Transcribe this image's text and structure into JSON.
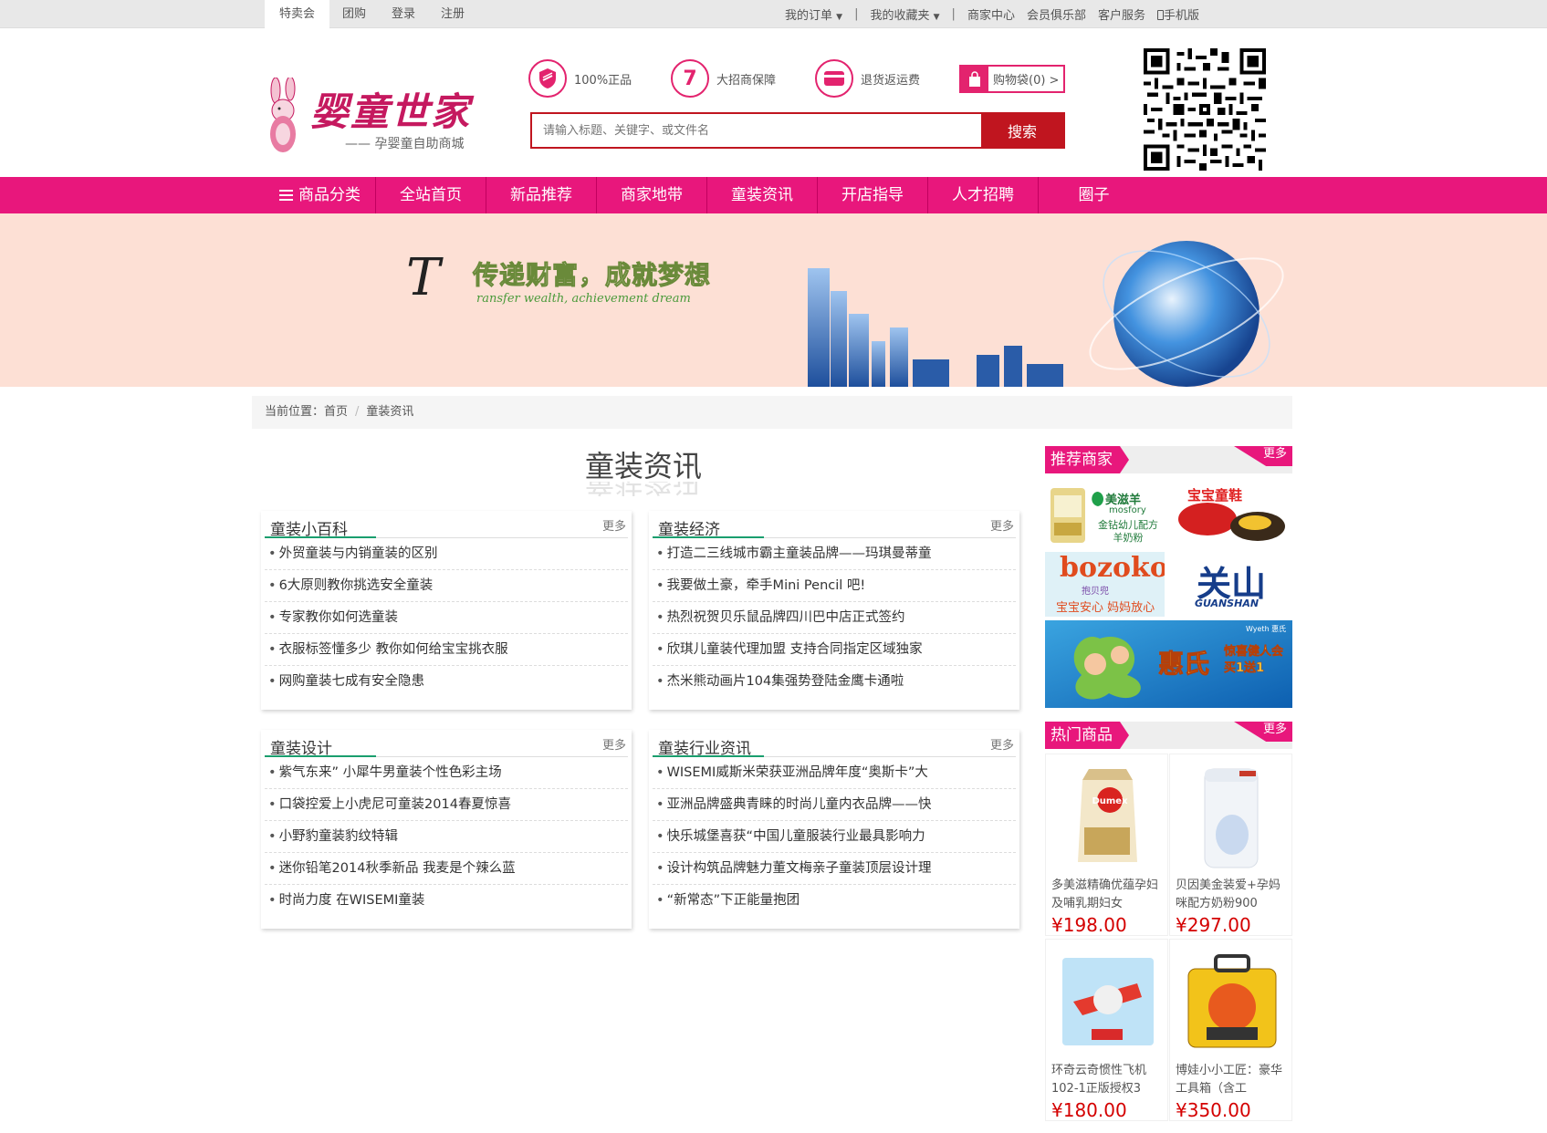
{
  "topbar": {
    "left": [
      "特卖会",
      "团购",
      "登录",
      "注册"
    ],
    "right": {
      "orders": "我的订单",
      "favorites": "我的收藏夹",
      "merchant_center": "商家中心",
      "member_club": "会员俱乐部",
      "customer_service": "客户服务",
      "mobile": "手机版"
    }
  },
  "logo": {
    "title": "婴童世家",
    "subtitle": "—— 孕婴童自助商城"
  },
  "features": [
    {
      "icon": "shield-icon",
      "label": "100%正品"
    },
    {
      "icon": "seven-icon",
      "icon_text": "7",
      "label": "大招商保障"
    },
    {
      "icon": "card-icon",
      "label": "退货返运费"
    }
  ],
  "cart": {
    "label": "购物袋(0) >"
  },
  "search": {
    "placeholder": "请输入标题、关键字、或文件名",
    "button": "搜索"
  },
  "nav": [
    "商品分类",
    "全站首页",
    "新品推荐",
    "商家地带",
    "童装资讯",
    "开店指导",
    "人才招聘",
    "圈子"
  ],
  "banner": {
    "slogan": "传递财富，成就梦想",
    "slogan_en": "ransfer wealth, achievement dream",
    "initial": "T"
  },
  "breadcrumb": {
    "prefix": "当前位置：",
    "home": "首页",
    "current": "童装资讯"
  },
  "section_title": "童装资讯",
  "more_label": "更多",
  "boxes": [
    {
      "title": "童装小百科",
      "items": [
        "外贸童装与内销童装的区别",
        "6大原则教你挑选安全童装",
        "专家教你如何选童装",
        "衣服标签懂多少 教你如何给宝宝挑衣服",
        "网购童装七成有安全隐患"
      ]
    },
    {
      "title": "童装经济",
      "items": [
        "打造二三线城市霸主童装品牌——玛琪曼蒂童",
        "我要做土豪，牵手Mini Pencil 吧!",
        "热烈祝贺贝乐鼠品牌四川巴中店正式签约",
        "欣琪儿童装代理加盟 支持合同指定区域独家",
        "杰米熊动画片104集强势登陆金鹰卡通啦"
      ]
    },
    {
      "title": "童装设计",
      "items": [
        "紫气东来” 小犀牛男童装个性色彩主场",
        "口袋控爱上小虎尼可童装2014春夏惊喜",
        "小野豹童装豹纹特辑",
        "迷你铅笔2014秋季新品 我麦是个辣么蓝",
        "时尚力度 在WISEMI童装"
      ]
    },
    {
      "title": "童装行业资讯",
      "items": [
        "WISEMI威斯米荣获亚洲品牌年度“奥斯卡”大",
        "亚洲品牌盛典青睐的时尚儿童内衣品牌——快",
        "快乐城堡喜获“中国儿童服装行业最具影响力",
        "设计构筑品牌魅力董文梅亲子童装顶层设计理",
        "“新常态”下正能量抱团"
      ]
    }
  ],
  "recommended": {
    "title": "推荐商家",
    "more": "更多",
    "brands": [
      {
        "name": "美滋羊",
        "sub": "mosfory",
        "tag": "金钻幼儿配方羊奶粉"
      },
      {
        "name": "宝宝童鞋"
      },
      {
        "name": "bozoko",
        "sub": "抱贝兜",
        "tag": "宝宝安心 妈妈放心"
      },
      {
        "name": "关山",
        "sub": "GUANSHAN"
      }
    ],
    "ad": {
      "brand": "惠氏",
      "tag": "Wyeth 惠氏",
      "promo": "惊喜健人会 买1送1"
    }
  },
  "hot": {
    "title": "热门商品",
    "more": "更多",
    "products": [
      {
        "name": "多美滋精确优蕴孕妇及哺乳期妇女",
        "price": "¥198.00",
        "img_text": "Dumex"
      },
      {
        "name": "贝因美金装爱+孕妈咪配方奶粉900",
        "price": "¥297.00"
      },
      {
        "name": "环奇云奇惯性飞机102-1正版授权3",
        "price": "¥180.00"
      },
      {
        "name": "博娃小小工匠：豪华工具箱（含工",
        "price": "¥350.00"
      }
    ]
  },
  "colors": {
    "brand": "#e8177c",
    "search": "#c0151f",
    "price": "#d40000",
    "accent_line": "#1a9e6e"
  }
}
